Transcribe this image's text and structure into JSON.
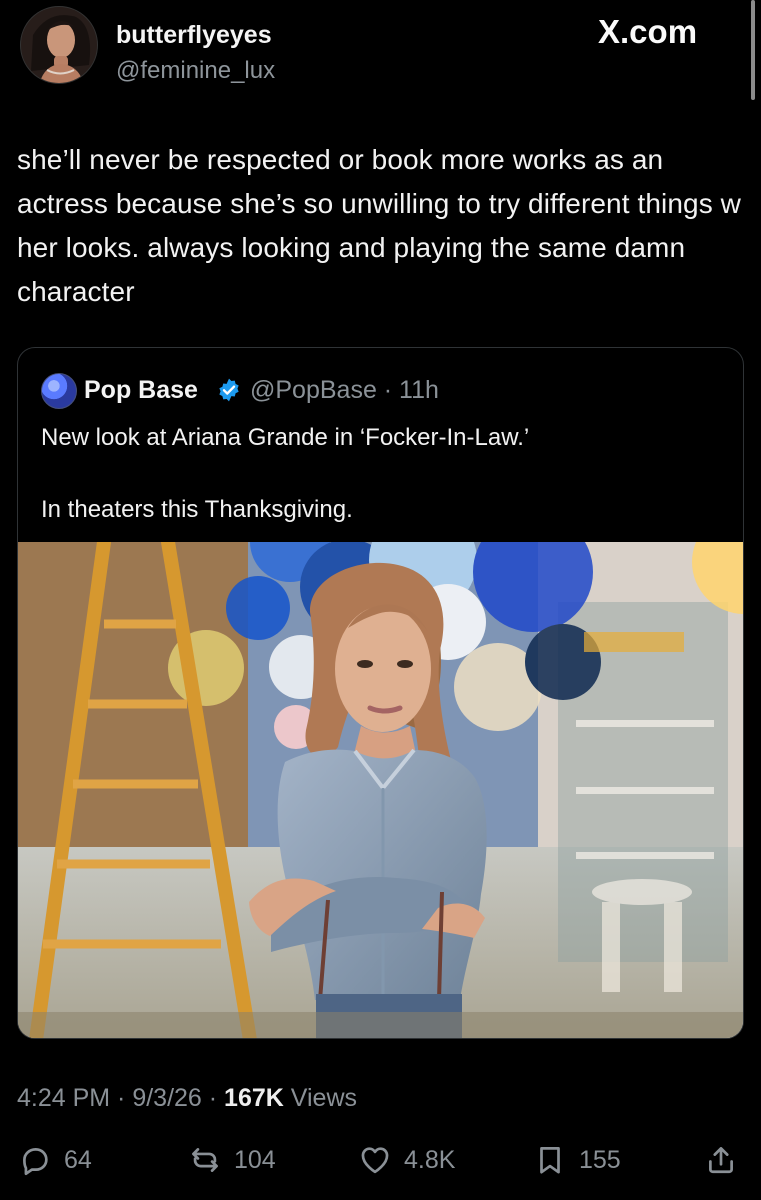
{
  "user": {
    "display_name": "butterflyeyes",
    "handle": "@feminine_lux",
    "avatar": "avatar"
  },
  "brand": {
    "label": "X.com"
  },
  "tweet": {
    "text": "she’ll never be respected or book more works as an actress because she’s so unwilling to try different things w her looks. always looking and playing the same damn character"
  },
  "quote": {
    "name": "Pop Base",
    "verified_icon": "verified-badge-icon",
    "handle_time": "@PopBase · 11h",
    "text_line_1": "New look at Ariana Grande in ‘Focker-In-Law.’",
    "text_line_2": "In theaters this Thanksgiving."
  },
  "meta": {
    "time_date": "4:24 PM · 9/3/26 · ",
    "views_count": "167K",
    "views_label": " Views"
  },
  "actions": {
    "reply_count": "64",
    "repost_count": "104",
    "like_count": "4.8K",
    "bookmark_count": "155",
    "reply_icon": "reply-icon",
    "repost_icon": "repost-icon",
    "like_icon": "heart-icon",
    "bookmark_icon": "bookmark-icon",
    "share_icon": "share-icon"
  },
  "colors": {
    "background": "#000000",
    "text": "#e7e9ea",
    "secondary_text": "#8a9096",
    "verified_blue": "#1d9bf0",
    "border": "#2f3336"
  }
}
